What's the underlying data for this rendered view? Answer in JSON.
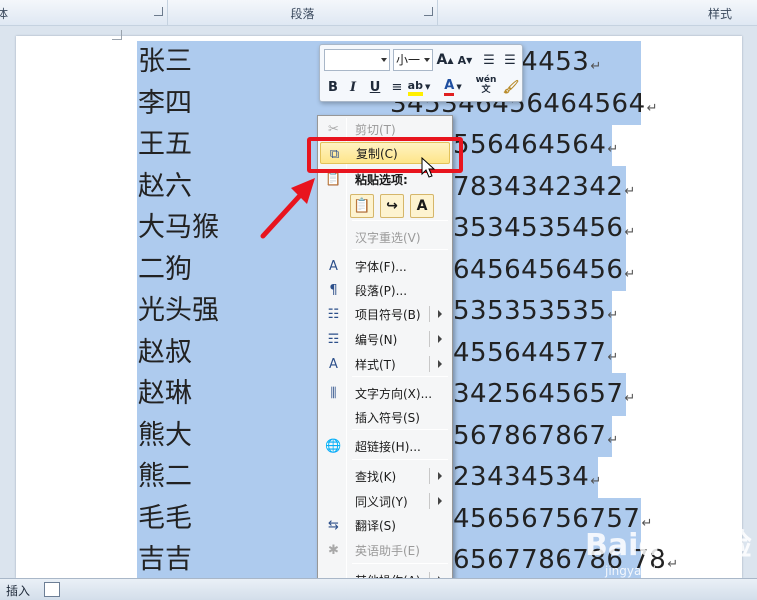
{
  "ribbon": {
    "groups": [
      "体",
      "段落",
      "样式"
    ]
  },
  "document": {
    "rows": [
      {
        "name": "张三",
        "number": "44444453"
      },
      {
        "name": "李四",
        "number": "345346456464564"
      },
      {
        "name": "王五",
        "number": "556464564"
      },
      {
        "name": "赵六",
        "number": "7834342342"
      },
      {
        "name": "大马猴",
        "number": "3534535456"
      },
      {
        "name": "二狗",
        "number": "6456456456"
      },
      {
        "name": "光头强",
        "number": "535353535"
      },
      {
        "name": "赵叔",
        "number": "455644577"
      },
      {
        "name": "赵琳",
        "number": "3425645657"
      },
      {
        "name": "熊大",
        "number": "567867867"
      },
      {
        "name": "熊二",
        "number": "23434534"
      },
      {
        "name": "毛毛",
        "number": "45656756757"
      },
      {
        "name": "吉吉",
        "number": "6567786786 78"
      }
    ],
    "paragraph_mark": "↵"
  },
  "mini_toolbar": {
    "font_value": "",
    "size_value": "小一",
    "grow_font": "A",
    "shrink_font": "A",
    "bold": "B",
    "italic": "I",
    "underline": "U",
    "font_color": "A",
    "phonetic": "wén 文"
  },
  "context_menu": {
    "items": [
      {
        "label": "剪切(T)",
        "icon": "scissors-icon",
        "enabled": false
      },
      {
        "label": "复制(C)",
        "icon": "copy-icon",
        "enabled": true,
        "highlighted": true
      },
      {
        "label": "粘贴选项:",
        "icon": "paste-icon",
        "enabled": true
      },
      {
        "label": "汉字重选(V)",
        "icon": "",
        "enabled": false
      },
      {
        "label": "字体(F)...",
        "icon": "font-icon",
        "enabled": true
      },
      {
        "label": "段落(P)...",
        "icon": "paragraph-icon",
        "enabled": true
      },
      {
        "label": "项目符号(B)",
        "icon": "bullets-icon",
        "enabled": true,
        "submenu": true
      },
      {
        "label": "编号(N)",
        "icon": "numbering-icon",
        "enabled": true,
        "submenu": true
      },
      {
        "label": "样式(T)",
        "icon": "styles-icon",
        "enabled": true,
        "submenu": true
      },
      {
        "label": "文字方向(X)...",
        "icon": "text-direction-icon",
        "enabled": true
      },
      {
        "label": "插入符号(S)",
        "icon": "",
        "enabled": true
      },
      {
        "label": "超链接(H)...",
        "icon": "hyperlink-icon",
        "enabled": true
      },
      {
        "label": "查找(K)",
        "icon": "",
        "enabled": true,
        "submenu": true
      },
      {
        "label": "同义词(Y)",
        "icon": "",
        "enabled": true,
        "submenu": true
      },
      {
        "label": "翻译(S)",
        "icon": "translate-icon",
        "enabled": true
      },
      {
        "label": "英语助手(E)",
        "icon": "english-assistant-icon",
        "enabled": false
      },
      {
        "label": "其他操作(A)",
        "icon": "",
        "enabled": true,
        "submenu": true
      }
    ],
    "paste_buttons": [
      "paste-keep-format",
      "paste-merge-format",
      "A"
    ]
  },
  "status_bar": {
    "mode": "插入"
  },
  "watermark": {
    "text": "Baidu 经验",
    "sub": "jingyan.baidu.com"
  },
  "colors": {
    "selection": "#aecbee",
    "highlight_box": "#e8141e",
    "menu_highlight": "#fde58a"
  }
}
